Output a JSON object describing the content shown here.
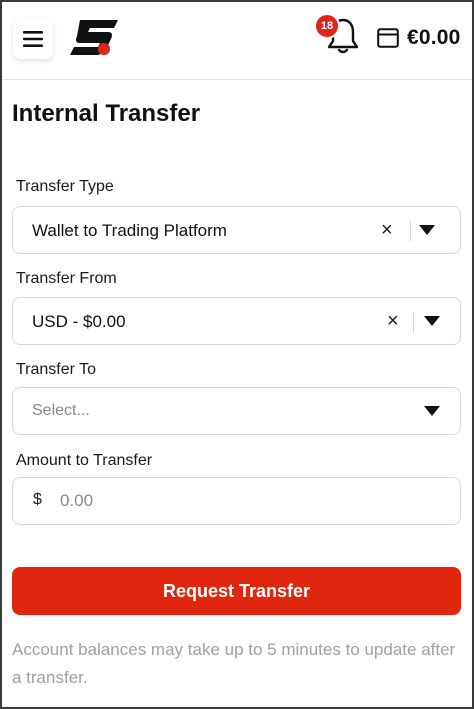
{
  "header": {
    "notification_count": "18",
    "balance": "€0.00",
    "brand_color": "#e0261a"
  },
  "page": {
    "title": "Internal Transfer"
  },
  "form": {
    "transfer_type": {
      "label": "Transfer Type",
      "value": "Wallet to Trading Platform",
      "clear": "×"
    },
    "transfer_from": {
      "label": "Transfer From",
      "value": "USD - $0.00",
      "clear": "×"
    },
    "transfer_to": {
      "label": "Transfer To",
      "placeholder": "Select..."
    },
    "amount": {
      "label": "Amount to Transfer",
      "currency": "$",
      "placeholder": "0.00"
    },
    "submit_label": "Request Transfer"
  },
  "note": "Account balances may take up to 5 minutes to update after a transfer.",
  "icons": [
    "hamburger-menu-icon",
    "brand-logo",
    "bell-icon",
    "wallet-icon",
    "close-icon",
    "chevron-down-icon"
  ]
}
